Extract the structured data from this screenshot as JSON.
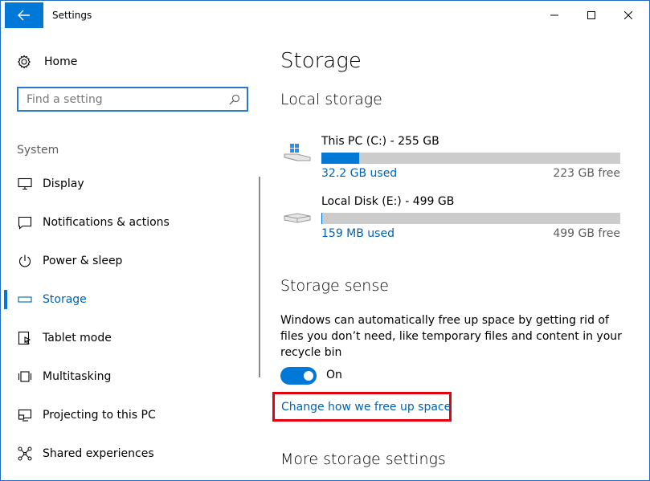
{
  "window": {
    "title": "Settings"
  },
  "nav": {
    "home_label": "Home",
    "search_placeholder": "Find a setting",
    "section": "System",
    "items": [
      {
        "label": "Display",
        "icon": "monitor-icon"
      },
      {
        "label": "Notifications & actions",
        "icon": "notification-icon"
      },
      {
        "label": "Power & sleep",
        "icon": "power-icon"
      },
      {
        "label": "Storage",
        "icon": "storage-icon",
        "active": true
      },
      {
        "label": "Tablet mode",
        "icon": "tablet-icon"
      },
      {
        "label": "Multitasking",
        "icon": "multitasking-icon"
      },
      {
        "label": "Projecting to this PC",
        "icon": "projecting-icon"
      },
      {
        "label": "Shared experiences",
        "icon": "shared-icon"
      }
    ]
  },
  "main": {
    "title": "Storage",
    "local_storage_heading": "Local storage",
    "drives": [
      {
        "name": "This PC (C:) - 255 GB",
        "used": "32.2 GB used",
        "free": "223 GB free",
        "used_fraction": 0.126
      },
      {
        "name": "Local Disk (E:) - 499 GB",
        "used": "159 MB used",
        "free": "499 GB free",
        "used_fraction": 0.0003
      }
    ],
    "storage_sense_heading": "Storage sense",
    "storage_sense_desc": "Windows can automatically free up space by getting rid of files you don’t need, like temporary files and content in your recycle bin",
    "toggle_label": "On",
    "toggle_on": true,
    "change_link": "Change how we free up space",
    "more_heading": "More storage settings"
  },
  "colors": {
    "accent": "#0078d7",
    "link": "#0063b1",
    "highlight_box": "#e3000f"
  }
}
